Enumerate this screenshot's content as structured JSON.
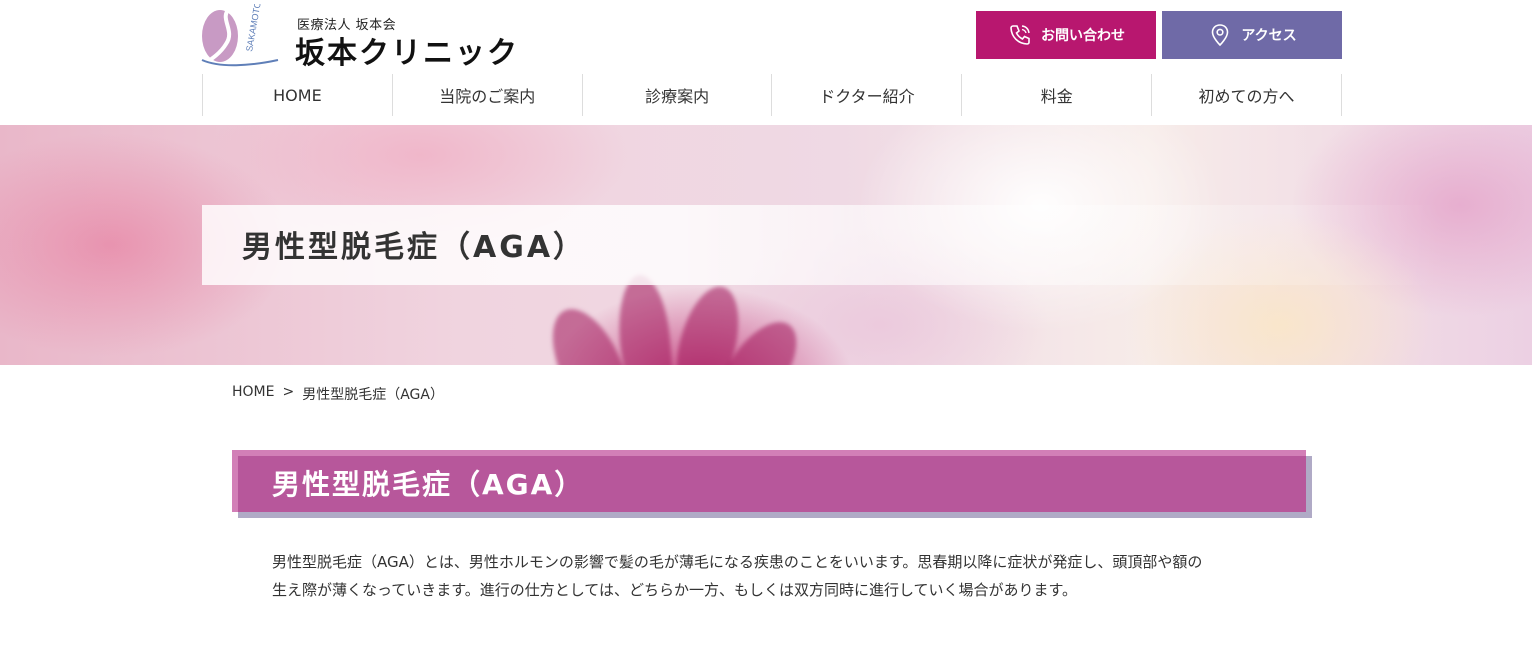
{
  "header": {
    "logo_sub": "医療法人 坂本会",
    "logo_main": "坂本クリニック",
    "logo_mark_text": "SAKAMOTO",
    "contact_label": "お問い合わせ",
    "access_label": "アクセス",
    "contact_color": "#b8176f",
    "access_color": "#6f6aa7"
  },
  "nav": {
    "items": [
      {
        "label": "HOME"
      },
      {
        "label": "当院のご案内"
      },
      {
        "label": "診療案内"
      },
      {
        "label": "ドクター紹介"
      },
      {
        "label": "料金"
      },
      {
        "label": "初めての方へ"
      }
    ]
  },
  "hero": {
    "title": "男性型脱毛症（AGA）"
  },
  "breadcrumb": {
    "home": "HOME",
    "separator": ">",
    "current": "男性型脱毛症（AGA）"
  },
  "section": {
    "title": "男性型脱毛症（AGA）",
    "accent_color": "#b7579b",
    "body_line1": "男性型脱毛症（AGA）とは、男性ホルモンの影響で髪の毛が薄毛になる疾患のことをいいます。思春期以降に症状が発症し、頭頂部や額の",
    "body_line2": "生え際が薄くなっていきます。進行の仕方としては、どちらか一方、もしくは双方同時に進行していく場合があります。"
  }
}
